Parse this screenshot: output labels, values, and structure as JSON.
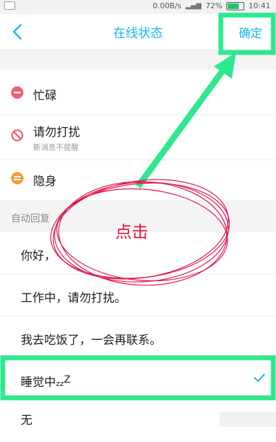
{
  "status_bar": {
    "net_speed": "0.00B/s",
    "battery": "72%",
    "time": "10:41"
  },
  "nav": {
    "title": "在线状态",
    "confirm": "确定"
  },
  "statuses": [
    {
      "label": "忙碌",
      "icon": "busy-icon",
      "color": "#ec5f72"
    },
    {
      "label": "请勿打扰",
      "sub": "新消息不提醒",
      "icon": "do-not-disturb-icon",
      "color": "#f04d5f"
    },
    {
      "label": "隐身",
      "icon": "invisible-icon",
      "color": "#f59b3a"
    }
  ],
  "auto_reply": {
    "header": "自动回复",
    "items": [
      {
        "text": "你好，"
      },
      {
        "text": "工作中，请勿打扰。"
      },
      {
        "text": "我去吃饭了，一会再联系。"
      },
      {
        "text": "睡觉中",
        "suffix_small": "z",
        "suffix_mid": "z",
        "suffix_big": "Z",
        "selected": true
      },
      {
        "text": "无"
      }
    ]
  },
  "annotation": {
    "label": "点击",
    "highlight_color": "#2ee88f",
    "circle_color": "#e0164a"
  },
  "colors": {
    "accent": "#12b7f5",
    "separator": "#f4f4f4"
  }
}
